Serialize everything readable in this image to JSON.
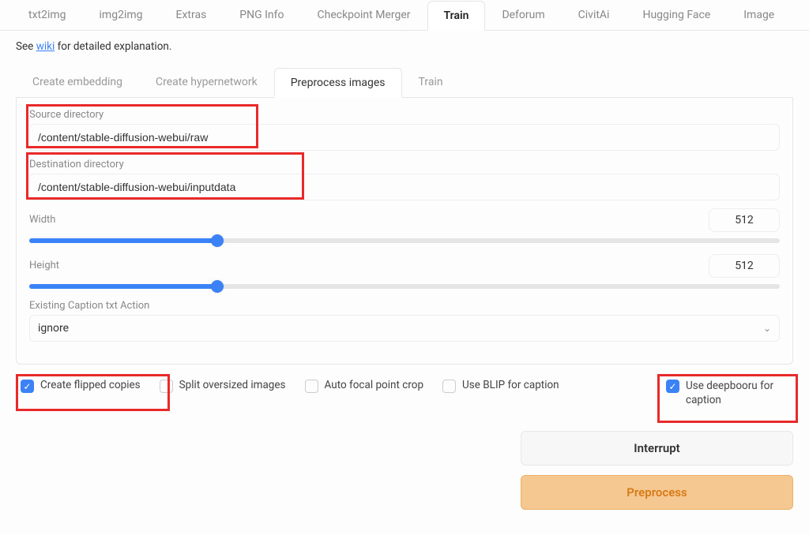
{
  "main_tabs": {
    "items": [
      "txt2img",
      "img2img",
      "Extras",
      "PNG Info",
      "Checkpoint Merger",
      "Train",
      "Deforum",
      "CivitAi",
      "Hugging Face",
      "Image"
    ],
    "active_index": 5
  },
  "wiki": {
    "prefix": "See ",
    "link": "wiki",
    "suffix": " for detailed explanation."
  },
  "sub_tabs": {
    "items": [
      "Create embedding",
      "Create hypernetwork",
      "Preprocess images",
      "Train"
    ],
    "active_index": 2
  },
  "fields": {
    "source_label": "Source directory",
    "source_value": "/content/stable-diffusion-webui/raw",
    "dest_label": "Destination directory",
    "dest_value": "/content/stable-diffusion-webui/inputdata",
    "width_label": "Width",
    "width_value": "512",
    "height_label": "Height",
    "height_value": "512",
    "caption_action_label": "Existing Caption txt Action",
    "caption_action_value": "ignore"
  },
  "checkboxes": {
    "flipped": {
      "label": "Create flipped copies",
      "checked": true
    },
    "split": {
      "label": "Split oversized images",
      "checked": false
    },
    "focal": {
      "label": "Auto focal point crop",
      "checked": false
    },
    "blip": {
      "label": "Use BLIP for caption",
      "checked": false
    },
    "deepbooru": {
      "label": "Use deepbooru for caption",
      "checked": true
    }
  },
  "buttons": {
    "interrupt": "Interrupt",
    "preprocess": "Preprocess"
  }
}
